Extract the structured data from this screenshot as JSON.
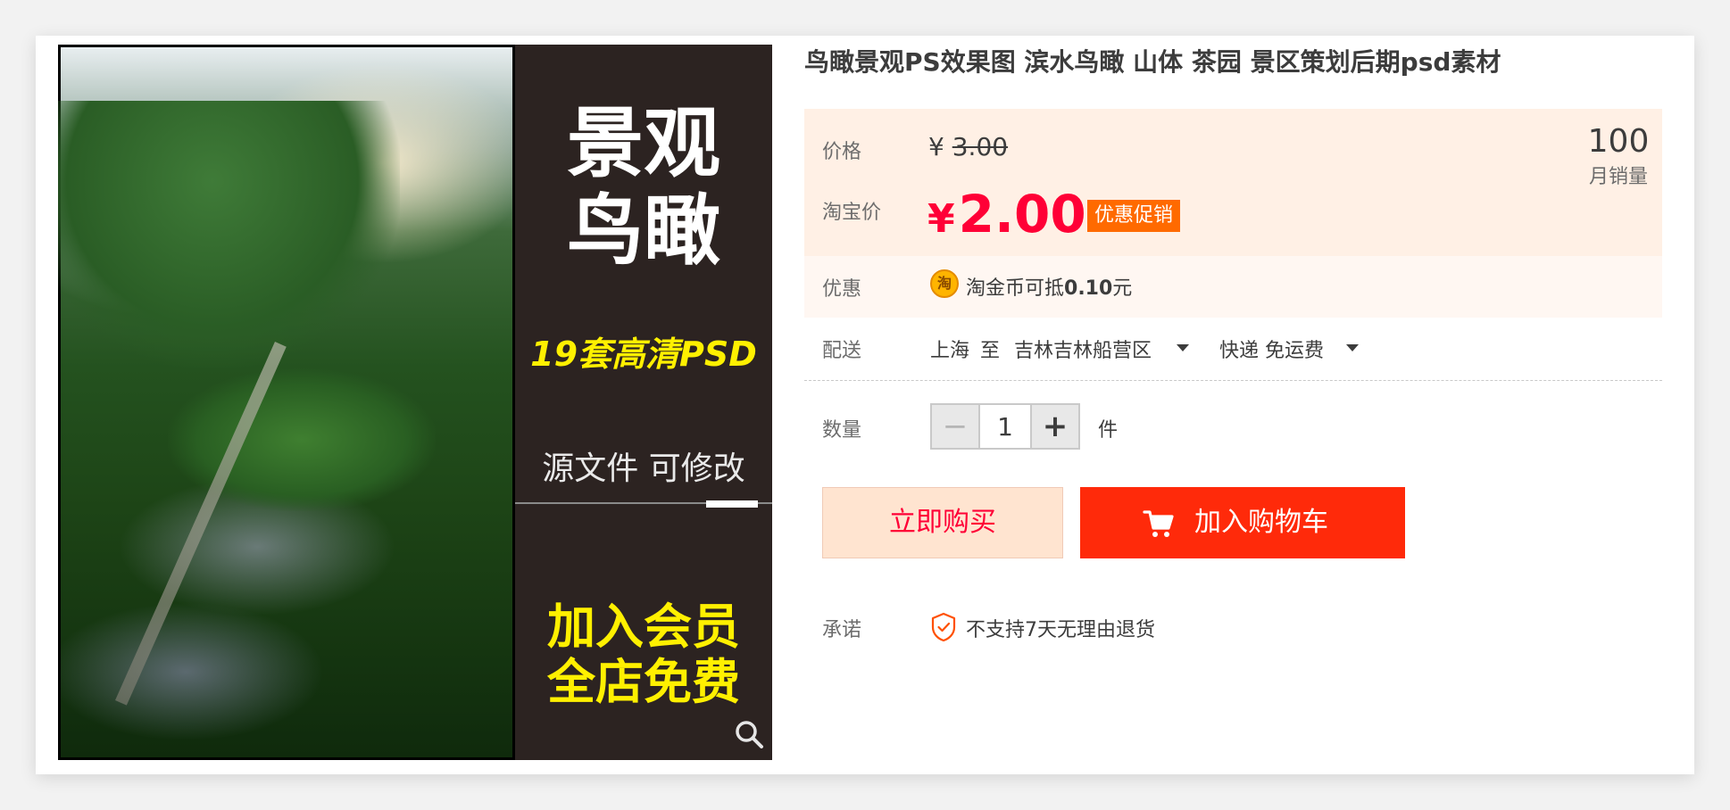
{
  "product": {
    "title": "鸟瞰景观PS效果图 滨水鸟瞰 山体 茶园 景区策划后期psd素材",
    "image": {
      "banner_line1": "景观",
      "banner_line2": "鸟瞰",
      "banner_sets": "19套高清PSD",
      "banner_editable": "源文件 可修改",
      "banner_member1": "加入会员",
      "banner_member2": "全店免费"
    }
  },
  "price": {
    "label": "价格",
    "currency": "¥",
    "original": "3.00",
    "taobao_label": "淘宝价",
    "sale": "2.00",
    "promo_badge": "优惠促销",
    "monthly_sales_count": "100",
    "monthly_sales_label": "月销量"
  },
  "discount": {
    "label": "优惠",
    "coin_glyph": "淘",
    "text_prefix": "淘金币可抵",
    "amount": "0.10",
    "unit": "元"
  },
  "delivery": {
    "label": "配送",
    "from": "上海",
    "to_word": "至",
    "destination": "吉林吉林船营区",
    "method": "快递 免运费"
  },
  "quantity": {
    "label": "数量",
    "minus": "−",
    "value": "1",
    "plus": "+",
    "unit": "件"
  },
  "actions": {
    "buy_now": "立即购买",
    "add_to_cart": "加入购物车"
  },
  "promise": {
    "label": "承诺",
    "text": "不支持7天无理由退货"
  },
  "colors": {
    "accent_red": "#ff0036",
    "cart_button": "#ff2a0a",
    "promo_badge": "#ff6a00",
    "price_bg": "#fff0e5"
  }
}
